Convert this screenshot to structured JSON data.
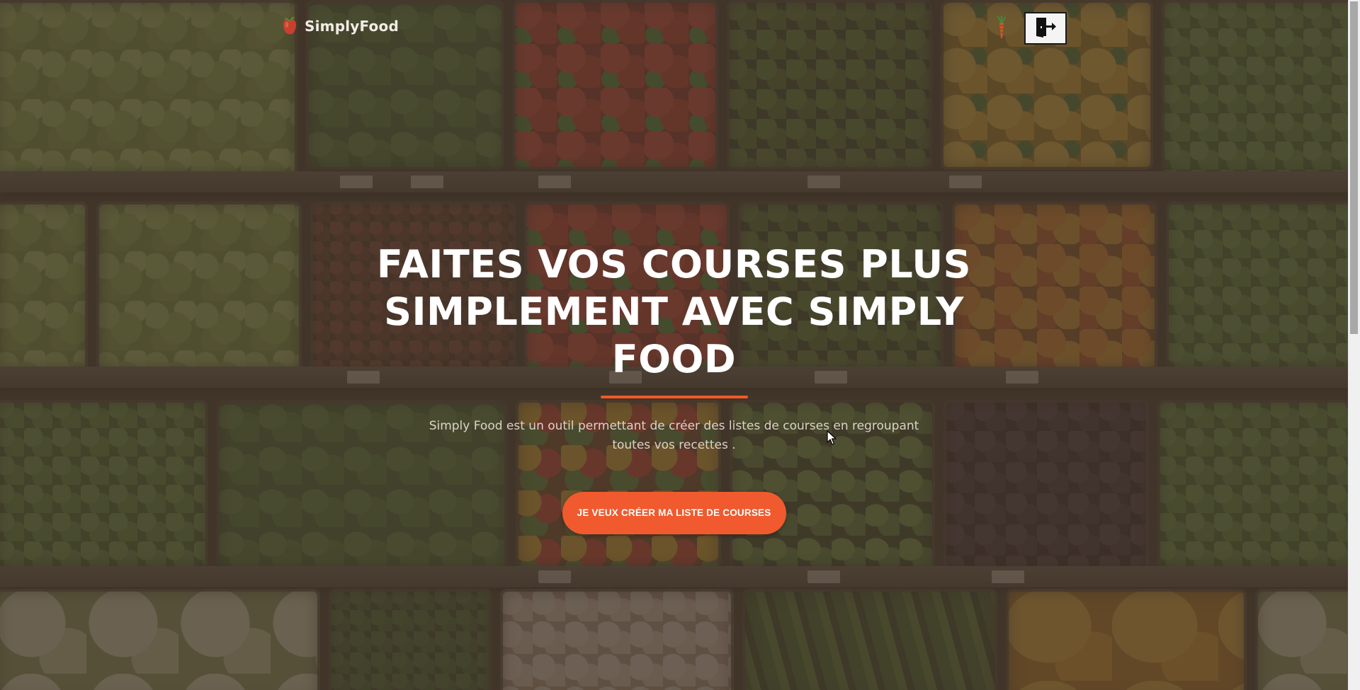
{
  "brand": {
    "name": "SimplyFood",
    "logo_icon": "apple-icon"
  },
  "header": {
    "carrot_icon": "carrot-icon",
    "logout_icon": "logout-door-icon"
  },
  "hero": {
    "title_line1": "FAITES VOS COURSES PLUS",
    "title_line2": "SIMPLEMENT AVEC SIMPLY FOOD",
    "description": "Simply Food est un outil permettant de créer des listes de courses en regroupant toutes vos recettes .",
    "cta_label": "JE VEUX CRÉER MA LISTE DE COURSES"
  },
  "colors": {
    "accent": "#f05a2e",
    "overlay": "#483a2e",
    "title": "#ffffff",
    "description": "#e8ded2"
  }
}
